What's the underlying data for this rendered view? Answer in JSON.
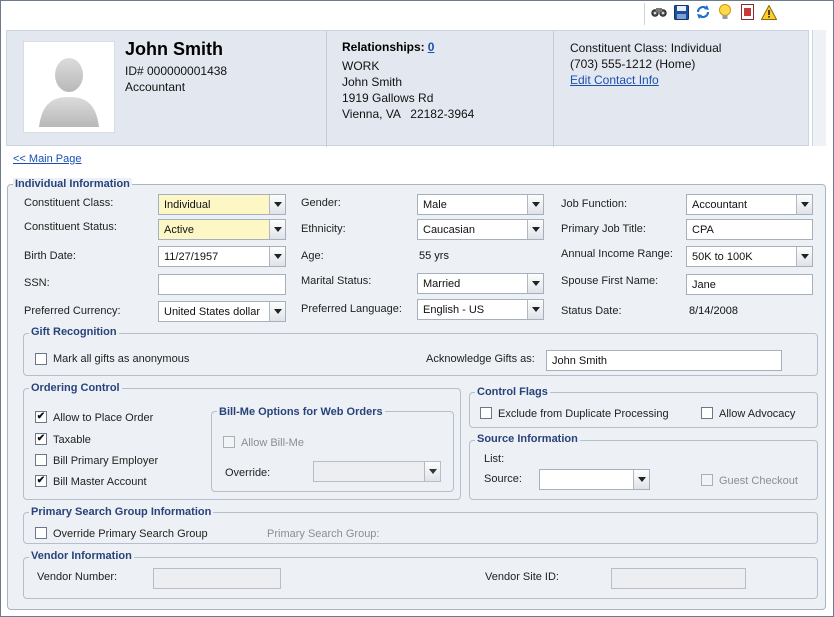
{
  "toolbar": {
    "icons": [
      "binoculars-icon",
      "save-icon",
      "refresh-icon",
      "lightbulb-icon",
      "report-icon",
      "warning-icon"
    ]
  },
  "header": {
    "name": "John Smith",
    "id_line": "ID# 000000001438",
    "job": "Accountant",
    "relationships_label": "Relationships:",
    "relationships_count": "0",
    "address": [
      "WORK",
      "John Smith",
      "1919 Gallows Rd",
      "Vienna, VA   22182-3964"
    ],
    "constituent_class_line": "Constituent Class: Individual",
    "phone_line": "(703) 555-1212 (Home)",
    "edit_contact": "Edit Contact Info"
  },
  "nav": {
    "main_page": "<< Main Page"
  },
  "individual": {
    "title": "Individual Information",
    "constituent_class_label": "Constituent Class:",
    "constituent_class_value": "Individual",
    "constituent_status_label": "Constituent Status:",
    "constituent_status_value": "Active",
    "birth_date_label": "Birth Date:",
    "birth_date_value": "11/27/1957",
    "ssn_label": "SSN:",
    "ssn_value": "",
    "currency_label": "Preferred Currency:",
    "currency_value": "United States dollar",
    "gender_label": "Gender:",
    "gender_value": "Male",
    "ethnicity_label": "Ethnicity:",
    "ethnicity_value": "Caucasian",
    "age_label": "Age:",
    "age_value": "55 yrs",
    "marital_label": "Marital Status:",
    "marital_value": "Married",
    "language_label": "Preferred Language:",
    "language_value": "English - US",
    "job_function_label": "Job Function:",
    "job_function_value": "Accountant",
    "job_title_label": "Primary Job Title:",
    "job_title_value": "CPA",
    "income_label": "Annual Income Range:",
    "income_value": "50K to 100K",
    "spouse_label": "Spouse First Name:",
    "spouse_value": "Jane",
    "status_date_label": "Status Date:",
    "status_date_value": "8/14/2008"
  },
  "gift": {
    "title": "Gift Recognition",
    "anonymous_label": "Mark all gifts as anonymous",
    "anonymous_checked": false,
    "acknowledge_label": "Acknowledge Gifts as:",
    "acknowledge_value": "John Smith"
  },
  "ordering": {
    "title": "Ordering Control",
    "items": [
      {
        "label": "Allow to Place Order",
        "checked": true
      },
      {
        "label": "Taxable",
        "checked": true
      },
      {
        "label": "Bill Primary Employer",
        "checked": false
      },
      {
        "label": "Bill Master Account",
        "checked": true
      }
    ],
    "billme_title": "Bill-Me Options for Web Orders",
    "allow_billme_label": "Allow Bill-Me",
    "override_label": "Override:",
    "override_value": ""
  },
  "control_flags": {
    "title": "Control Flags",
    "exclude_label": "Exclude from Duplicate Processing",
    "advocacy_label": "Allow Advocacy"
  },
  "source": {
    "title": "Source Information",
    "list_label": "List:",
    "source_label": "Source:",
    "source_value": "",
    "guest_label": "Guest Checkout"
  },
  "search_group": {
    "title": "Primary Search Group Information",
    "override_label": "Override Primary Search Group",
    "primary_label": "Primary Search Group:"
  },
  "vendor": {
    "title": "Vendor Information",
    "number_label": "Vendor Number:",
    "number_value": "",
    "site_label": "Vendor Site ID:",
    "site_value": ""
  }
}
